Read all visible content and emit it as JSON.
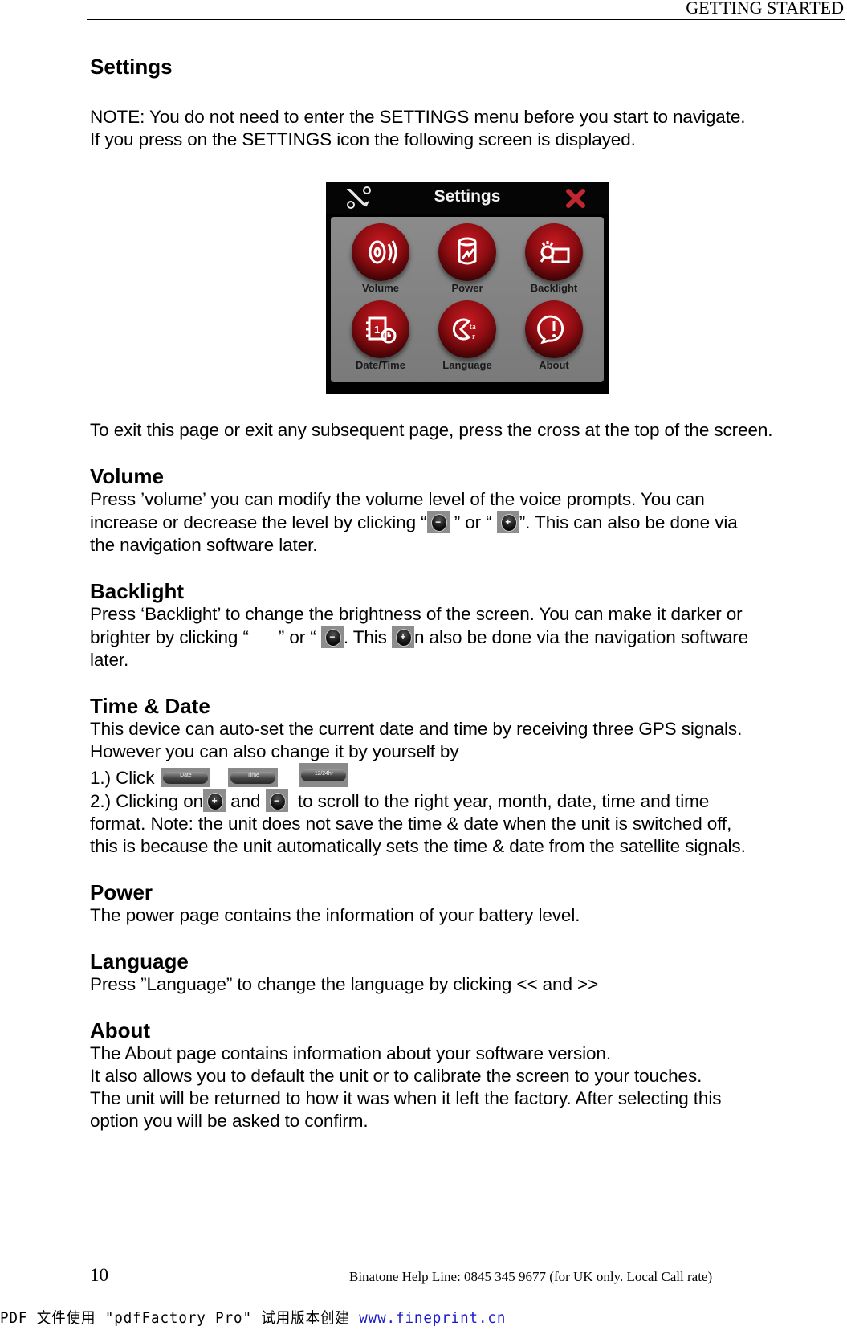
{
  "header": {
    "running_title": "GETTING STARTED"
  },
  "page": {
    "title": "Settings",
    "note_lines": [
      "NOTE: You do not need to enter the SETTINGS menu before you start to navigate.",
      "If you press on the SETTINGS icon the following screen is displayed."
    ],
    "exit_text": "To exit this page or exit any subsequent page, press the cross at the top of the screen."
  },
  "device_screen": {
    "title": "Settings",
    "buttons": [
      {
        "label": "Volume",
        "icon": "speaker-icon"
      },
      {
        "label": "Power",
        "icon": "battery-icon"
      },
      {
        "label": "Backlight",
        "icon": "lamp-icon"
      },
      {
        "label": "Date/Time",
        "icon": "calendar-clock-icon"
      },
      {
        "label": "Language",
        "icon": "language-icon"
      },
      {
        "label": "About",
        "icon": "info-icon"
      }
    ],
    "colors": {
      "orb": "#8e0d12",
      "panel": "#7f7f7f",
      "titlebar": "#050505",
      "close": "#c0282f"
    }
  },
  "sections": {
    "volume": {
      "heading": "Volume",
      "line1": "Press ’volume’ you can modify the volume level of the voice prompts. You can",
      "line2_a": "increase or decrease the level by clicking “",
      "line2_b": " ” or “ ",
      "line2_c": "”. This can also be done via",
      "line3": "the navigation software later."
    },
    "backlight": {
      "heading": "Backlight",
      "line1": "Press ‘Backlight’ to change the brightness of the screen. You can make it darker or",
      "line2_a": "brighter by clicking “      ” or “ ",
      "line2_b": ". This ",
      "line2_c": "n also be done via the navigation software",
      "line3": "later."
    },
    "time_date": {
      "heading": "Time & Date",
      "line1": "This device can auto-set the current date and time by receiving three GPS signals.",
      "line2": "However you can also change it by yourself by",
      "step1_label": "1.) Click",
      "step1_buttons": [
        "Date",
        "Time",
        "12/24hr"
      ],
      "step2_a": "2.) Clicking on",
      "step2_b": " and ",
      "step2_c": "  to scroll to the right year, month, date, time and time",
      "line5": "format. Note: the unit does not save the time & date when the unit is switched off,",
      "line6": "this is because the unit automatically sets the time & date from the satellite signals."
    },
    "power": {
      "heading": "Power",
      "line1": "The power page contains the information of your battery level."
    },
    "language": {
      "heading": "Language",
      "line1": "Press ”Language” to change the language by clicking << and >>"
    },
    "about": {
      "heading": "About",
      "lines": [
        "The About page contains information about your software version.",
        "It also allows you to default the unit or to calibrate the screen to your touches.",
        "The unit will be returned to how it was when it left the factory. After selecting this",
        "option you will be asked to confirm."
      ]
    }
  },
  "inline_icons": {
    "minus": "−",
    "plus": "+"
  },
  "footer": {
    "page_number": "10",
    "help_line": "Binatone Help Line: 0845 345 9677 (for UK only. Local Call rate)",
    "watermark_text": "PDF 文件使用 \"pdfFactory Pro\" 试用版本创建 ",
    "watermark_link": "www.fineprint.cn"
  }
}
